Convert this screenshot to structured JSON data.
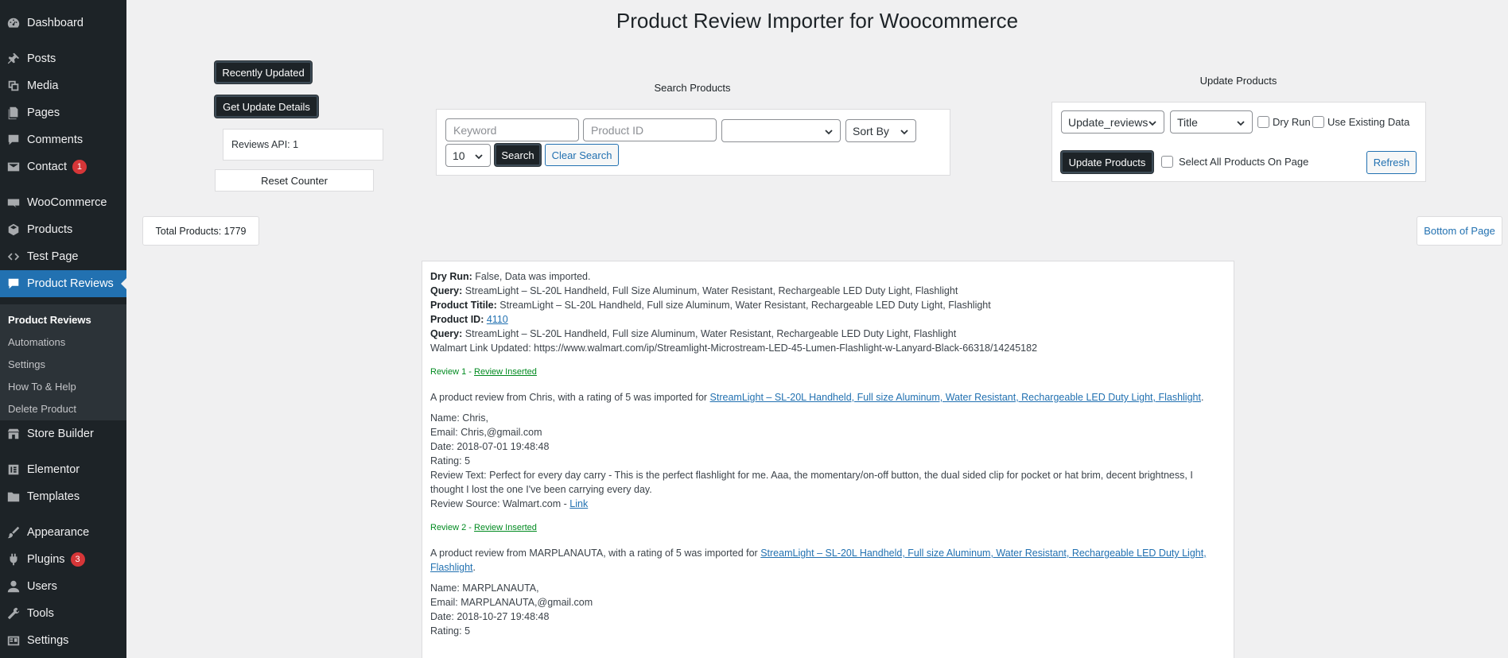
{
  "sidebar": {
    "items": [
      {
        "label": "Dashboard",
        "icon": "dashboard-icon"
      },
      {
        "label": "Posts",
        "icon": "pin-icon"
      },
      {
        "label": "Media",
        "icon": "media-icon"
      },
      {
        "label": "Pages",
        "icon": "pages-icon"
      },
      {
        "label": "Comments",
        "icon": "comment-icon"
      },
      {
        "label": "Contact",
        "icon": "mail-icon",
        "badge": "1"
      },
      {
        "label": "WooCommerce",
        "icon": "woo-icon"
      },
      {
        "label": "Products",
        "icon": "box-icon"
      },
      {
        "label": "Test Page",
        "icon": "code-icon"
      },
      {
        "label": "Product Reviews",
        "icon": "comment-icon"
      },
      {
        "label": "Store Builder",
        "icon": "store-icon"
      },
      {
        "label": "Elementor",
        "icon": "elementor-icon"
      },
      {
        "label": "Templates",
        "icon": "folder-icon"
      },
      {
        "label": "Appearance",
        "icon": "brush-icon"
      },
      {
        "label": "Plugins",
        "icon": "plug-icon",
        "badge": "3"
      },
      {
        "label": "Users",
        "icon": "user-icon"
      },
      {
        "label": "Tools",
        "icon": "wrench-icon"
      },
      {
        "label": "Settings",
        "icon": "settings-icon"
      }
    ],
    "submenu": [
      "Product Reviews",
      "Automations",
      "Settings",
      "How To & Help",
      "Delete Product"
    ]
  },
  "page": {
    "title": "Product Review Importer for Woocommerce"
  },
  "left_panel": {
    "recently_updated": "Recently Updated",
    "get_update_details": "Get Update Details",
    "reviews_api": "Reviews API: 1",
    "reset_counter": "Reset Counter",
    "total_products": "Total Products: 1779"
  },
  "search": {
    "heading": "Search Products",
    "keyword_placeholder": "Keyword",
    "product_id_placeholder": "Product ID",
    "category_value": "",
    "sort_by": "Sort By",
    "per_page": "10",
    "search_button": "Search",
    "clear_button": "Clear Search"
  },
  "update": {
    "heading": "Update Products",
    "action_select": "Update_reviews",
    "field_select": "Title",
    "dry_run": "Dry Run",
    "use_existing": "Use Existing Data",
    "update_button": "Update Products",
    "select_all": "Select All Products On Page",
    "refresh_button": "Refresh",
    "bottom_of_page": "Bottom of Page"
  },
  "log": {
    "dry_run_label": "Dry Run:",
    "dry_run_value": " False, Data was imported.",
    "query_label": "Query:",
    "query_value": " StreamLight – SL-20L Handheld, Full Size Aluminum, Water Resistant, Rechargeable LED Duty Light, Flashlight",
    "title_label": "Product Titile:",
    "title_value": " StreamLight – SL-20L Handheld, Full size Aluminum, Water Resistant, Rechargeable LED Duty Light, Flashlight",
    "id_label": "Product ID:",
    "id_value": "4110",
    "query2_label": "Query:",
    "query2_value": " StreamLight – SL-20L Handheld, Full size Aluminum, Water Resistant, Rechargeable LED Duty Light, Flashlight",
    "walmart": "Walmart Link Updated: https://www.walmart.com/ip/Streamlight-Microstream-LED-45-Lumen-Flashlight-w-Lanyard-Black-66318/14245182",
    "product_link": "StreamLight – SL-20L Handheld, Full size Aluminum, Water Resistant, Rechargeable LED Duty Light, Flashlight",
    "reviews": [
      {
        "head": "Review 1 - ",
        "status": "Review Inserted",
        "intro": "A product review from Chris, with a rating of 5 was imported for ",
        "name": "Name: Chris,",
        "email": "Email: Chris,@gmail.com",
        "date": "Date: 2018-07-01 19:48:48",
        "rating": "Rating: 5",
        "text": "Review Text: Perfect for every day carry - This is the perfect flashlight for me. Aaa, the momentary/on-off button, the dual sided clip for pocket or hat brim, decent brightness, I thought I lost the one I've been carrying every day.",
        "source": "Review Source: Walmart.com - ",
        "source_link": "Link"
      },
      {
        "head": "Review 2 - ",
        "status": "Review Inserted",
        "intro": "A product review from MARPLANAUTA, with a rating of 5 was imported for ",
        "name": "Name: MARPLANAUTA,",
        "email": "Email: MARPLANAUTA,@gmail.com",
        "date": "Date: 2018-10-27 19:48:48",
        "rating": "Rating: 5"
      }
    ]
  }
}
